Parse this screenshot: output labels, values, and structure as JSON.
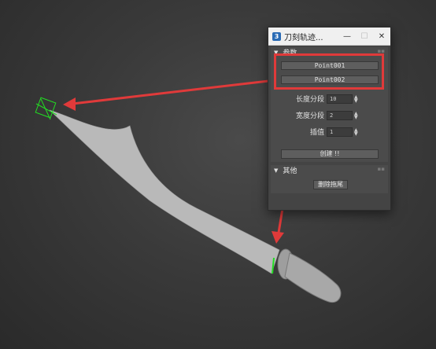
{
  "window": {
    "title": "刀刻轨迹...",
    "icon_glyph": "3",
    "minimize_glyph": "—",
    "maximize_glyph": "☐",
    "close_glyph": "✕"
  },
  "params_rollout": {
    "title": "参数",
    "point1_label": "Point001",
    "point2_label": "Point002",
    "length_segments": {
      "label": "长度分段",
      "value": "10"
    },
    "width_segments": {
      "label": "宽度分段",
      "value": "2"
    },
    "interpolation": {
      "label": "插值",
      "value": "1"
    },
    "create_label": "创建 !!"
  },
  "other_rollout": {
    "title": "其他",
    "delete_trail_label": "删除拖尾"
  },
  "colors": {
    "arrow": "#e03a3a",
    "blade": "#b9b9b9",
    "helper": "#22dd22"
  }
}
